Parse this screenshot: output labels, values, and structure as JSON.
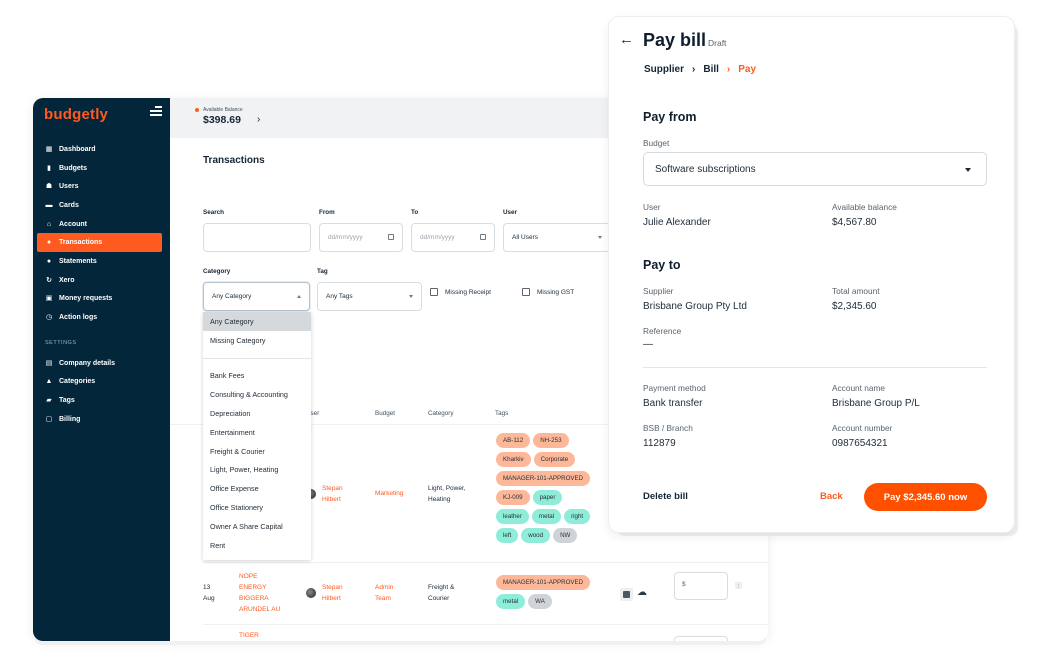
{
  "brand": {
    "name": "budgetly",
    "accent": "#ff5a1f",
    "sidebar_bg": "#04263b"
  },
  "sidebar": {
    "items": [
      {
        "label": "Dashboard",
        "icon": "dashboard-icon",
        "glyph": "▦"
      },
      {
        "label": "Budgets",
        "icon": "bar-chart-icon",
        "glyph": "▮"
      },
      {
        "label": "Users",
        "icon": "users-icon",
        "glyph": "☗"
      },
      {
        "label": "Cards",
        "icon": "card-icon",
        "glyph": "▬"
      },
      {
        "label": "Account",
        "icon": "bank-icon",
        "glyph": "⌂"
      },
      {
        "label": "Transactions",
        "icon": "dollar-circle-icon",
        "glyph": "●",
        "active": true
      },
      {
        "label": "Statements",
        "icon": "statement-icon",
        "glyph": "●"
      },
      {
        "label": "Xero",
        "icon": "sync-icon",
        "glyph": "↻"
      },
      {
        "label": "Money requests",
        "icon": "money-request-icon",
        "glyph": "▣"
      },
      {
        "label": "Action logs",
        "icon": "history-icon",
        "glyph": "◷"
      }
    ],
    "settings_heading": "SETTINGS",
    "settings_items": [
      {
        "label": "Company details",
        "icon": "building-icon",
        "glyph": "▤"
      },
      {
        "label": "Categories",
        "icon": "categories-icon",
        "glyph": "▲"
      },
      {
        "label": "Tags",
        "icon": "tag-icon",
        "glyph": "▰"
      },
      {
        "label": "Billing",
        "icon": "calendar-icon",
        "glyph": "▢"
      }
    ]
  },
  "topbar": {
    "balance_label": "Available Balance",
    "balance_value": "$398.69",
    "chevron": "›"
  },
  "page": {
    "title": "Transactions"
  },
  "filters": {
    "search": {
      "label": "Search",
      "value": ""
    },
    "from": {
      "label": "From",
      "placeholder": "dd/mm/yyyy"
    },
    "to": {
      "label": "To",
      "placeholder": "dd/mm/yyyy"
    },
    "user": {
      "label": "User",
      "value": "All Users"
    },
    "category": {
      "label": "Category",
      "value": "Any Category"
    },
    "tag": {
      "label": "Tag",
      "value": "Any Tags"
    },
    "missing_receipt": {
      "label": "Missing Receipt",
      "checked": false
    },
    "missing_gst": {
      "label": "Missing GST",
      "checked": false
    }
  },
  "category_dropdown": {
    "top_options": [
      "Any Category",
      "Missing Category"
    ],
    "selected": "Any Category",
    "options": [
      "Bank Fees",
      "Consulting & Accounting",
      "Depreciation",
      "Entertainment",
      "Freight & Courier",
      "Light, Power, Heating",
      "Office Expense",
      "Office Stationery",
      "Owner A Share Capital",
      "Rent"
    ]
  },
  "table": {
    "columns": [
      "User",
      "Budget",
      "Category",
      "Tags"
    ],
    "rows": [
      {
        "user": [
          "Stepan",
          "Hilbert"
        ],
        "budget": [
          "Marketing"
        ],
        "category": [
          "Light, Power,",
          "Heating"
        ],
        "tags": [
          {
            "label": "AB-112",
            "color": "salmon"
          },
          {
            "label": "NH-253",
            "color": "salmon"
          },
          {
            "label": "Kharkiv",
            "color": "salmon"
          },
          {
            "label": "Corporate",
            "color": "salmon"
          },
          {
            "label": "MANAGER-101-APPROVED",
            "color": "salmon"
          },
          {
            "label": "KJ-009",
            "color": "salmon"
          },
          {
            "label": "paper",
            "color": "mint"
          },
          {
            "label": "leather",
            "color": "mint"
          },
          {
            "label": "metal",
            "color": "mint"
          },
          {
            "label": "right",
            "color": "mint"
          },
          {
            "label": "left",
            "color": "mint"
          },
          {
            "label": "wood",
            "color": "mint"
          },
          {
            "label": "NW",
            "color": "grey"
          }
        ]
      },
      {
        "date": [
          "13",
          "Aug"
        ],
        "merchant": [
          "NOPE",
          "ENERGY",
          "BIGGERA",
          "ARUNDEL AU"
        ],
        "user": [
          "Stepan",
          "Hilbert"
        ],
        "budget": [
          "Admin",
          "Team"
        ],
        "category": [
          "Freight &",
          "Courier"
        ],
        "tags": [
          {
            "label": "MANAGER-101-APPROVED",
            "color": "salmon"
          },
          {
            "label": "metal",
            "color": "mint"
          },
          {
            "label": "WA",
            "color": "grey"
          }
        ],
        "amount_placeholder": "$"
      },
      {
        "merchant": [
          "TIGER"
        ]
      }
    ]
  },
  "pay_bill": {
    "title": "Pay bill",
    "status": "Draft",
    "breadcrumb": [
      {
        "label": "Supplier"
      },
      {
        "label": "Bill"
      },
      {
        "label": "Pay",
        "current": true
      }
    ],
    "pay_from": {
      "heading": "Pay from",
      "budget_label": "Budget",
      "budget_value": "Software subscriptions",
      "user_label": "User",
      "user_value": "Julie Alexander",
      "balance_label": "Available balance",
      "balance_value": "$4,567.80"
    },
    "pay_to": {
      "heading": "Pay to",
      "supplier_label": "Supplier",
      "supplier_value": "Brisbane Group Pty Ltd",
      "total_label": "Total amount",
      "total_value": "$2,345.60",
      "reference_label": "Reference",
      "reference_value": "—"
    },
    "payment": {
      "method_label": "Payment method",
      "method_value": "Bank transfer",
      "account_name_label": "Account name",
      "account_name_value": "Brisbane Group P/L",
      "bsb_label": "BSB / Branch",
      "bsb_value": "112879",
      "account_number_label": "Account number",
      "account_number_value": "0987654321"
    },
    "actions": {
      "delete": "Delete bill",
      "back": "Back",
      "pay": "Pay $2,345.60 now"
    }
  }
}
